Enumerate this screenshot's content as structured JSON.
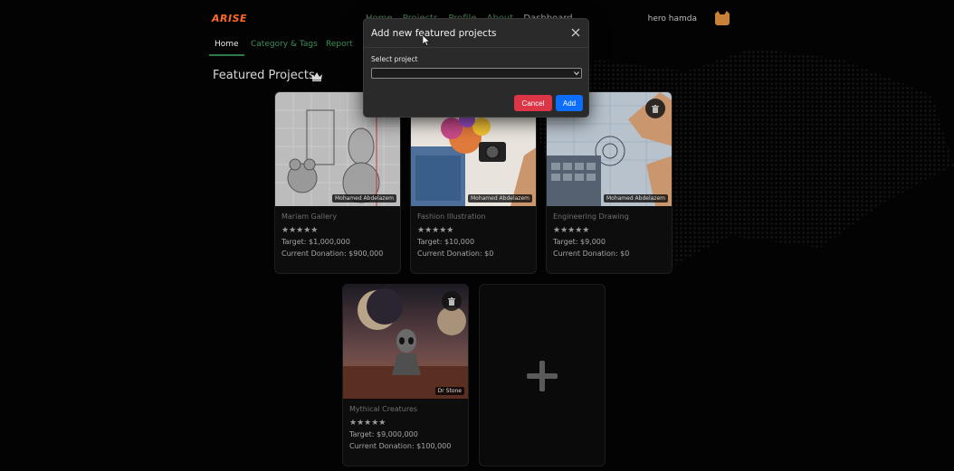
{
  "app": {
    "logo": "ARISE",
    "top_nav": [
      "Home",
      "Projects",
      "Profile",
      "About",
      "Dashboard"
    ],
    "user_name": "hero hamda"
  },
  "tabs": [
    "Home",
    "Category & Tags",
    "Report"
  ],
  "section_title": "Featured Projects",
  "cards": [
    {
      "name": "Mariam Gallery",
      "author": "Mohamed Abdelazem",
      "stars": "★★★★★",
      "target": "Target: $1,000,000",
      "donation": "Current Donation: $900,000"
    },
    {
      "name": "Fashion Illustration",
      "author": "Mohamed Abdelazem",
      "stars": "★★★★★",
      "target": "Target: $10,000",
      "donation": "Current Donation: $0"
    },
    {
      "name": "Engineering Drawing",
      "author": "Mohamed Abdelazem",
      "stars": "★★★★★",
      "target": "Target: $9,000",
      "donation": "Current Donation: $0"
    },
    {
      "name": "Mythical Creatures",
      "author": "Dr Stone",
      "stars": "★★★★★",
      "target": "Target: $9,000,000",
      "donation": "Current Donation: $100,000"
    }
  ],
  "modal": {
    "title": "Add new featured projects",
    "label": "Select project",
    "select_value": "",
    "cancel_label": "Cancel",
    "add_label": "Add"
  },
  "colors": {
    "accent_green": "#3e8d5a",
    "cancel_red": "#dc3545",
    "add_blue": "#0d6efd",
    "logo_orange": "#ff6a2a"
  }
}
